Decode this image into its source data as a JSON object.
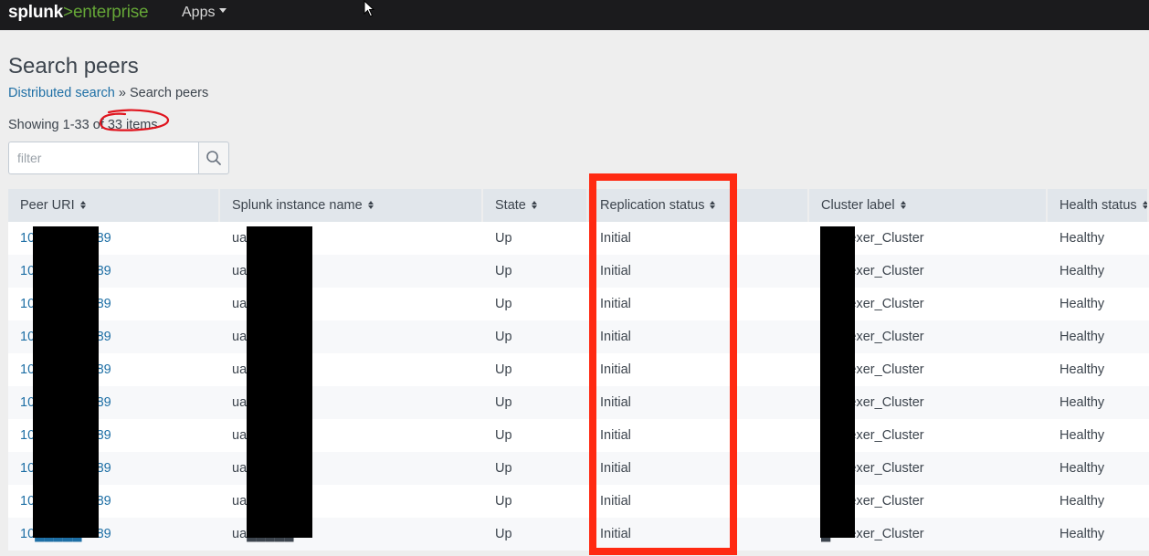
{
  "topbar": {
    "logo_part1": "splunk",
    "logo_part2": ">",
    "logo_part3": "enterprise",
    "apps_label": "Apps"
  },
  "page": {
    "title": "Search peers",
    "breadcrumb_link": "Distributed search",
    "breadcrumb_sep": " » ",
    "breadcrumb_current": "Search peers",
    "count_text": "Showing 1-33 of 33 items",
    "filter_placeholder": "filter"
  },
  "table": {
    "columns": [
      "Peer URI",
      "Splunk instance name",
      "State",
      "Replication status",
      "Cluster label",
      "Health status"
    ],
    "rows": [
      {
        "peer_uri": "10█████8089",
        "instance": "ua█████",
        "state": "Up",
        "replication": "Initial",
        "cluster": "█Indexer_Cluster",
        "health": "Healthy"
      },
      {
        "peer_uri": "10█████8089",
        "instance": "ua█████",
        "state": "Up",
        "replication": "Initial",
        "cluster": "█Indexer_Cluster",
        "health": "Healthy"
      },
      {
        "peer_uri": "10█████8089",
        "instance": "ua█████",
        "state": "Up",
        "replication": "Initial",
        "cluster": "█Indexer_Cluster",
        "health": "Healthy"
      },
      {
        "peer_uri": "10█████8089",
        "instance": "ua█████",
        "state": "Up",
        "replication": "Initial",
        "cluster": "█Indexer_Cluster",
        "health": "Healthy"
      },
      {
        "peer_uri": "10█████8089",
        "instance": "ua█████",
        "state": "Up",
        "replication": "Initial",
        "cluster": "█Indexer_Cluster",
        "health": "Healthy"
      },
      {
        "peer_uri": "10█████8089",
        "instance": "ua█████",
        "state": "Up",
        "replication": "Initial",
        "cluster": "█Indexer_Cluster",
        "health": "Healthy"
      },
      {
        "peer_uri": "10█████8089",
        "instance": "ua█████",
        "state": "Up",
        "replication": "Initial",
        "cluster": "█Indexer_Cluster",
        "health": "Healthy"
      },
      {
        "peer_uri": "10█████8089",
        "instance": "ua█████",
        "state": "Up",
        "replication": "Initial",
        "cluster": "█Indexer_Cluster",
        "health": "Healthy"
      },
      {
        "peer_uri": "10█████8089",
        "instance": "ua█████",
        "state": "Up",
        "replication": "Initial",
        "cluster": "█Indexer_Cluster",
        "health": "Healthy"
      },
      {
        "peer_uri": "10█████8089",
        "instance": "ua█████",
        "state": "Up",
        "replication": "Initial",
        "cluster": "█Indexer_Cluster",
        "health": "Healthy"
      }
    ]
  },
  "colors": {
    "topbar_bg": "#1b1b1d",
    "brand_green": "#65a637",
    "link_blue": "#1e6fa5",
    "annotation_red": "#ff2a12",
    "header_bg": "#e1e6eb"
  },
  "icons": {
    "filter_button": "search-icon",
    "apps_caret": "caret-down-icon",
    "column_sort": "sort-icon",
    "cursor": "mouse-pointer-icon"
  }
}
